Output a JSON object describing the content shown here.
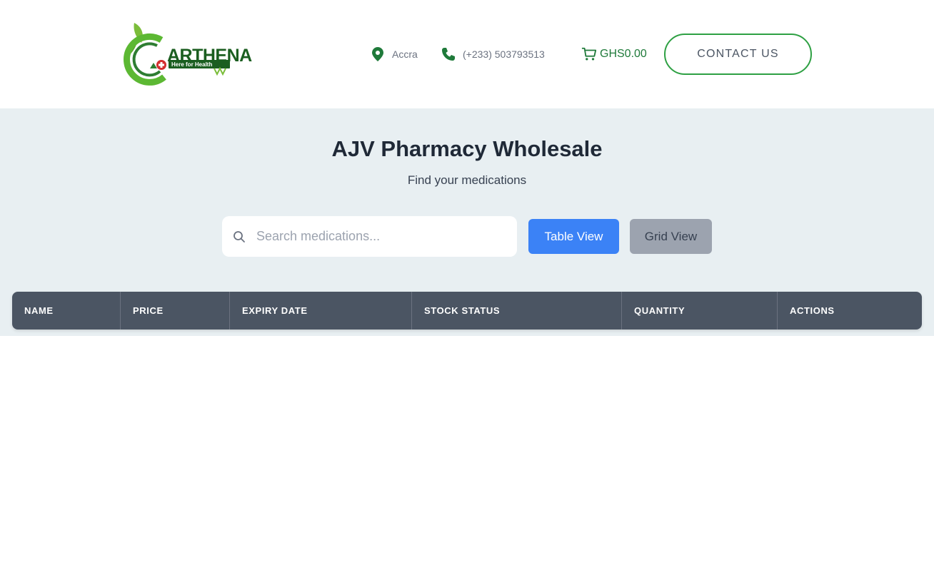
{
  "header": {
    "logo_text": "ARTHENA",
    "logo_tagline": "Here for Health",
    "location": "Accra",
    "phone": "(+233) 503793513",
    "cart_total": "GHS0.00",
    "contact_button": "CONTACT US"
  },
  "hero": {
    "title": "AJV Pharmacy Wholesale",
    "subtitle": "Find your medications",
    "search_placeholder": "Search medications...",
    "table_view_label": "Table View",
    "grid_view_label": "Grid View"
  },
  "table": {
    "columns": [
      "NAME",
      "PRICE",
      "EXPIRY DATE",
      "STOCK STATUS",
      "QUANTITY",
      "ACTIONS"
    ]
  },
  "colors": {
    "brand_green": "#2ea043",
    "primary_blue": "#3b82f6",
    "table_header": "#4b5563",
    "hero_bg": "#e8eff2"
  },
  "icons": {
    "location": "map-pin-icon",
    "phone": "phone-icon",
    "cart": "cart-icon",
    "search": "search-icon"
  }
}
